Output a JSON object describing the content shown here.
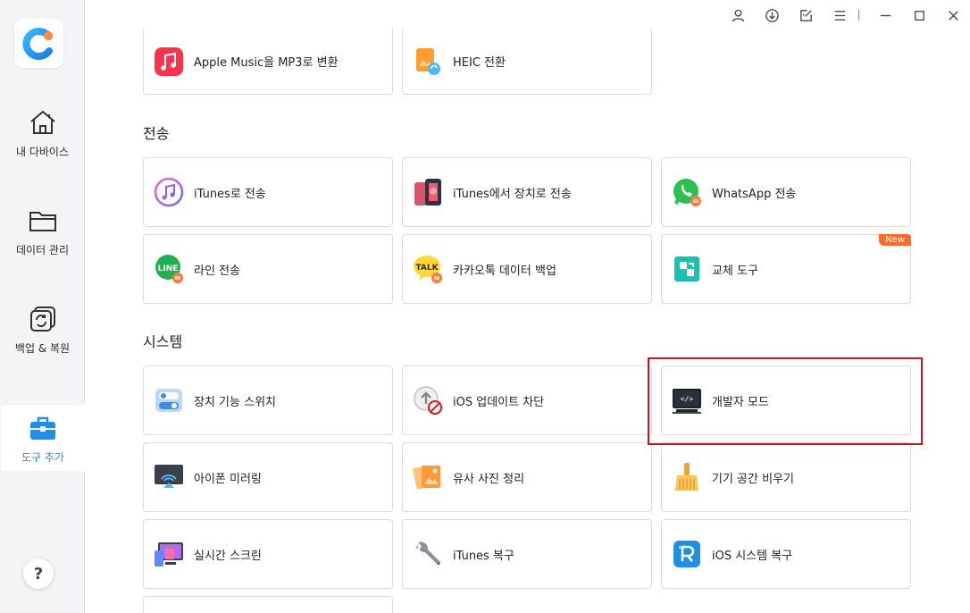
{
  "sidebar": {
    "items": [
      {
        "label": "내 다바이스",
        "icon": "home-icon"
      },
      {
        "label": "데이터 관리",
        "icon": "folder-icon"
      },
      {
        "label": "백업 & 복원",
        "icon": "backup-restore-icon"
      },
      {
        "label": "도구 추가",
        "icon": "toolbox-icon",
        "active": true
      }
    ],
    "help_label": "?"
  },
  "sections": {
    "transfer": "전송",
    "system": "시스템"
  },
  "cards": {
    "apple_music": "Apple Music을 MP3로 변환",
    "heic": "HEIC 전환",
    "itunes_transfer": "iTunes로 전송",
    "itunes_device": "iTunes에서 장치로 전송",
    "whatsapp": "WhatsApp 전송",
    "line": "라인 전송",
    "kakao": "카카오톡 데이터 백업",
    "swap": "교체 도구",
    "swap_badge": "New",
    "switch": "장치 기능 스위치",
    "ios_block": "iOS 업데이트 차단",
    "dev_mode": "개발자 모드",
    "mirror": "아이폰 미러링",
    "similar_photos": "유사 사진 정리",
    "clean": "기기 공간 비우기",
    "screen": "실시간 스크린",
    "itunes_repair": "iTunes 복구",
    "ios_repair": "iOS 시스템 복구"
  },
  "icon_text": {
    "line": "LINE",
    "talk": "TALK",
    "code": "</>"
  },
  "colors": {
    "accent": "#1f8fe6",
    "highlight": "#d0101e",
    "badge": "#ff6a2a"
  }
}
